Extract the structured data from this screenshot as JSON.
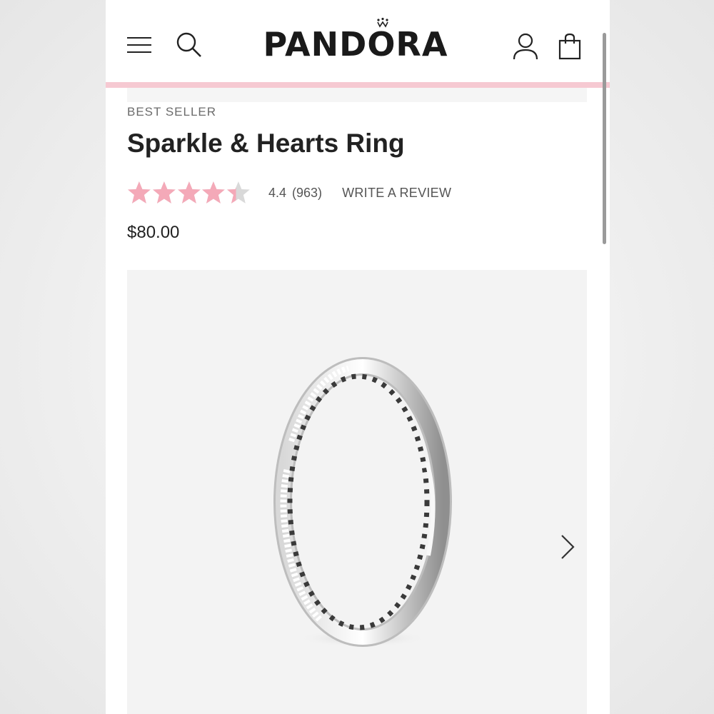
{
  "brand": {
    "logo_text": "PANDORA",
    "accent_color": "#f6c9d2",
    "star_color": "#f4a9b8"
  },
  "header": {
    "icons": {
      "menu": "hamburger-menu-icon",
      "search": "search-icon",
      "account": "account-icon",
      "bag": "shopping-bag-icon"
    }
  },
  "product": {
    "badge": "BEST SELLER",
    "title": "Sparkle & Hearts Ring",
    "rating": {
      "value": "4.4",
      "count": "(963)",
      "stars": 4.4,
      "max_stars": 5
    },
    "review_link": "WRITE A REVIEW",
    "price": "$80.00"
  },
  "gallery": {
    "next_icon": "chevron-right-icon"
  }
}
